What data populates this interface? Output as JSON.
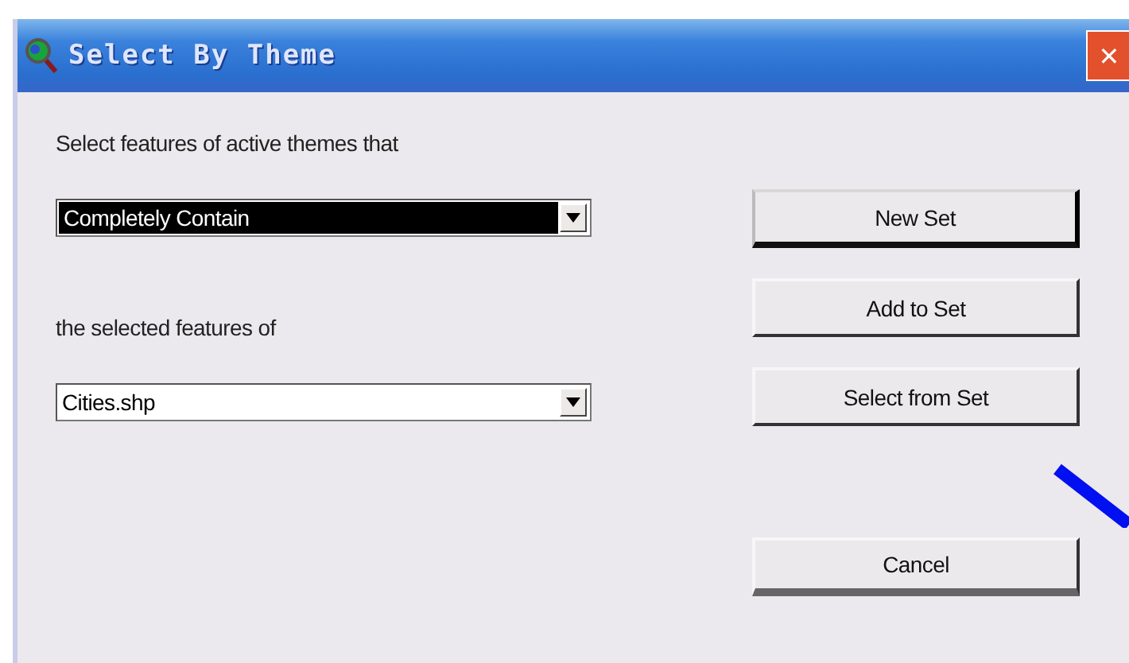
{
  "window": {
    "title": "Select By Theme",
    "close": "✕"
  },
  "fields": [
    {
      "label": "Select features of active themes that",
      "value": "Completely Contain",
      "highlighted": true
    },
    {
      "label": "the selected features of",
      "value": "Cities.shp",
      "highlighted": false
    }
  ],
  "buttons": [
    {
      "label": "New Set",
      "kind": "primary"
    },
    {
      "label": "Add to Set",
      "kind": "normal"
    },
    {
      "label": "Select from Set",
      "kind": "normal"
    },
    {
      "label": "Cancel",
      "kind": "cancel"
    }
  ]
}
